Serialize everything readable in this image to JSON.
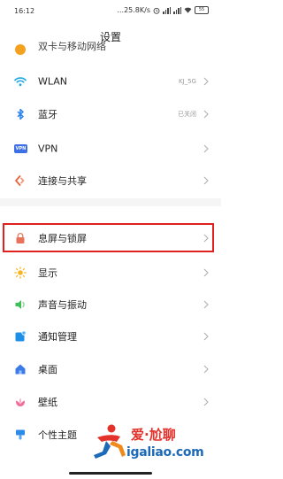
{
  "status_bar": {
    "time": "16:12",
    "network_speed": "...25.8K/s",
    "battery": "55"
  },
  "header": {
    "title": "设置"
  },
  "settings": {
    "mobile_network_label": "双卡与移动网络",
    "wlan": {
      "label": "WLAN",
      "value": "KJ_5G"
    },
    "bluetooth": {
      "label": "蓝牙",
      "value": "已关闭"
    },
    "vpn": {
      "label": "VPN",
      "icon_text": "VPN"
    },
    "connection_share": {
      "label": "连接与共享"
    },
    "lock_screen": {
      "label": "息屏与锁屏"
    },
    "display": {
      "label": "显示"
    },
    "sound": {
      "label": "声音与振动"
    },
    "notifications": {
      "label": "通知管理"
    },
    "desktop": {
      "label": "桌面"
    },
    "wallpaper": {
      "label": "壁纸"
    },
    "themes": {
      "label": "个性主题"
    }
  },
  "watermark": {
    "title": "爱·尬聊",
    "url": "igaliao.com"
  },
  "colors": {
    "highlight_border": "#e0201f",
    "accent_blue": "#2b84f0",
    "watermark_red": "#e3322b",
    "watermark_blue": "#1d6ab8"
  }
}
